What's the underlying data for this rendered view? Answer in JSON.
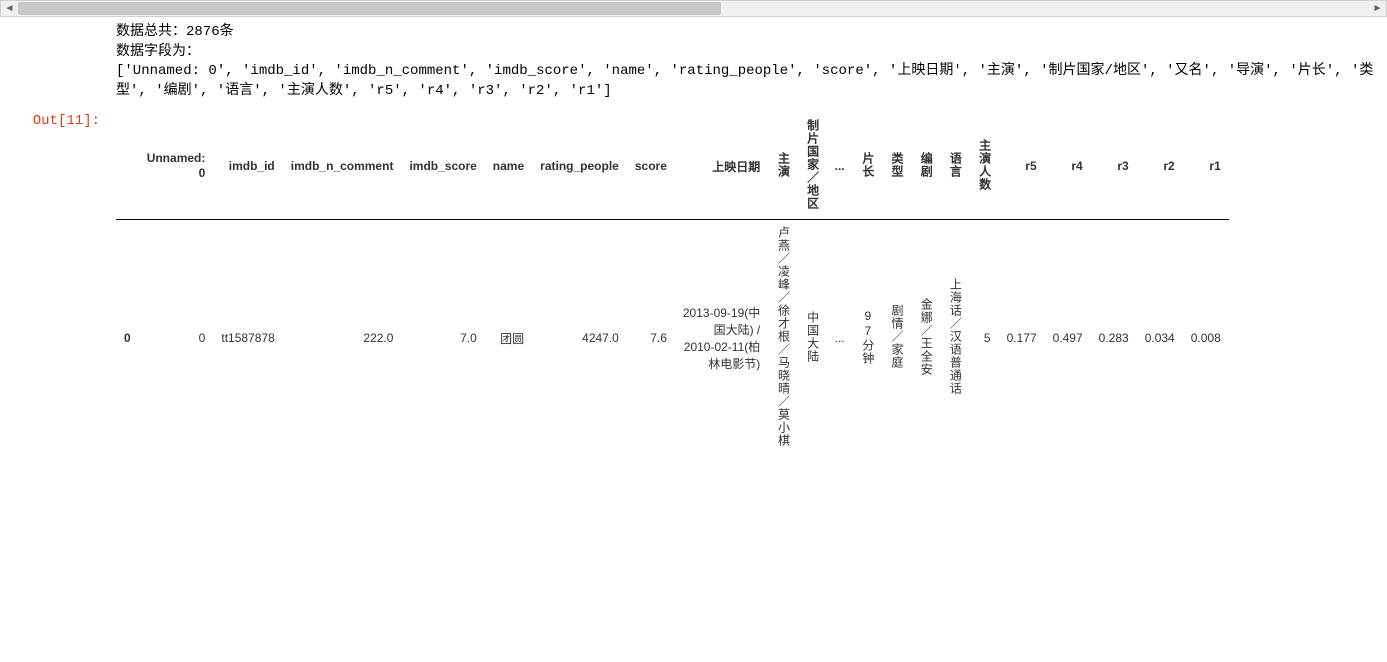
{
  "stdout": {
    "line1": "数据总共：2876条",
    "line2": "数据字段为：",
    "line3": "['Unnamed: 0', 'imdb_id', 'imdb_n_comment', 'imdb_score', 'name', 'rating_people', 'score', '上映日期', '主演', '制片国家/地区', '又名', '导演', '片长', '类型', '编剧', '语言', '主演人数', 'r5', 'r4', 'r3', 'r2', 'r1']"
  },
  "prompt": "Out[11]:",
  "table": {
    "headers": {
      "idx": "",
      "unnamed0_l1": "Unnamed:",
      "unnamed0_l2": "0",
      "imdb_id": "imdb_id",
      "imdb_n_comment": "imdb_n_comment",
      "imdb_score": "imdb_score",
      "name": "name",
      "rating_people": "rating_people",
      "score": "score",
      "release": "上映日期",
      "cast": "主演",
      "country": "制片国家／地区",
      "ellipsis": "...",
      "duration": "片长",
      "genre": "类型",
      "writer": "编剧",
      "language": "语言",
      "cast_count": "主演人数",
      "r5": "r5",
      "r4": "r4",
      "r3": "r3",
      "r2": "r2",
      "r1": "r1"
    },
    "row0": {
      "idx": "0",
      "unnamed0": "0",
      "imdb_id": "tt1587878",
      "imdb_n_comment": "222.0",
      "imdb_score": "7.0",
      "name": "团圆",
      "rating_people": "4247.0",
      "score": "7.6",
      "release_l1": "2013-09-19(中",
      "release_l2": "国大陆) /",
      "release_l3": "2010-02-11(柏",
      "release_l4": "林电影节)",
      "cast": "卢燕／凌峰／徐才根／马晓晴／莫小棋",
      "country": "中国大陆",
      "ellipsis": "...",
      "duration": "97分钟",
      "genre": "剧情／家庭",
      "writer": "金娜／王全安",
      "language": "上海话／汉语普通话",
      "cast_count": "5",
      "r5": "0.177",
      "r4": "0.497",
      "r3": "0.283",
      "r2": "0.034",
      "r1": "0.008"
    }
  }
}
